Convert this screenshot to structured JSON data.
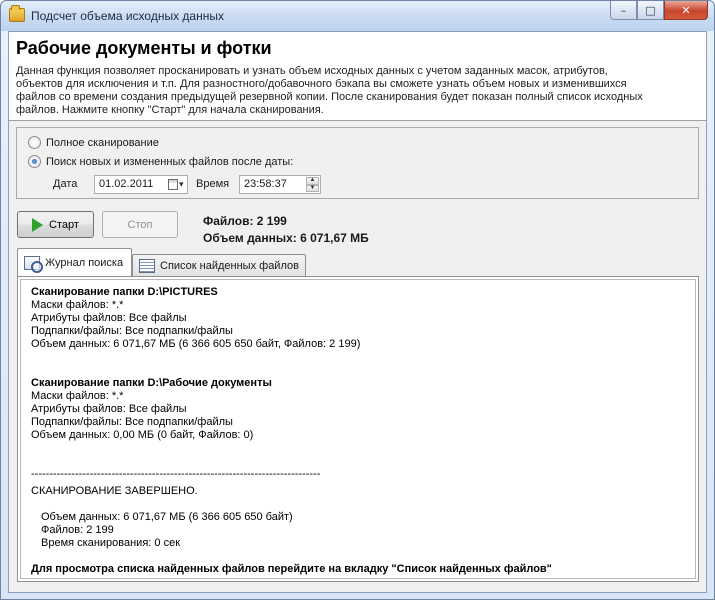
{
  "window": {
    "title": "Подсчет объема исходных данных",
    "controls": {
      "minimize": "–",
      "maximize": "□",
      "close": "✕"
    }
  },
  "header": {
    "heading": "Рабочие документы и фотки",
    "description": "Данная функция позволяет просканировать и узнать объем исходных данных с учетом заданных масок, атрибутов, объектов для исключения и т.п. Для разностного/добавочного бэкапа вы сможете узнать объем новых и изменившихся файлов со времени создания предыдущей резервной копии. После сканирования будет показан полный список исходных файлов. Нажмите кнопку \"Старт\" для начала сканирования."
  },
  "options": {
    "full_scan_label": "Полное сканирование",
    "new_files_label": "Поиск новых и измененных файлов после даты:",
    "selected": "new_files",
    "date_label": "Дата",
    "date_value": "01.02.2011",
    "time_label": "Время",
    "time_value": "23:58:37"
  },
  "actions": {
    "start_label": "Старт",
    "stop_label": "Стоп"
  },
  "stats": {
    "files": "Файлов: 2 199",
    "size": "Объем данных: 6 071,67 МБ"
  },
  "tabs": [
    {
      "label": "Журнал поиска",
      "icon": "journal-search-icon",
      "active": true
    },
    {
      "label": "Список найденных файлов",
      "icon": "file-list-icon",
      "active": false
    }
  ],
  "log": {
    "scan1_title": "Сканирование папки  D:\\PICTURES",
    "scan1_masks": "Маски файлов: *.*",
    "scan1_attrs": "Атрибуты файлов: Все файлы",
    "scan1_folders": "Подпапки/файлы: Все подпапки/файлы",
    "scan1_volume": "Объем данных: 6 071,67 МБ (6 366 605 650 байт,  Файлов: 2 199)",
    "scan2_title": "Сканирование папки  D:\\Рабочие документы",
    "scan2_masks": "Маски файлов: *.*",
    "scan2_attrs": "Атрибуты файлов: Все файлы",
    "scan2_folders": "Подпапки/файлы: Все подпапки/файлы",
    "scan2_volume": "Объем данных: 0,00 МБ (0 байт,  Файлов: 0)",
    "separator": "-------------------------------------------------------------------------------",
    "done": "СКАНИРОВАНИЕ ЗАВЕРШЕНО.",
    "total_volume": "Объем данных: 6 071,67 МБ (6 366 605 650 байт)",
    "total_files": "Файлов: 2 199",
    "scan_time": "Время сканирования: 0 сек",
    "hint": "Для просмотра списка найденных файлов перейдите на вкладку \"Список найденных файлов\""
  }
}
